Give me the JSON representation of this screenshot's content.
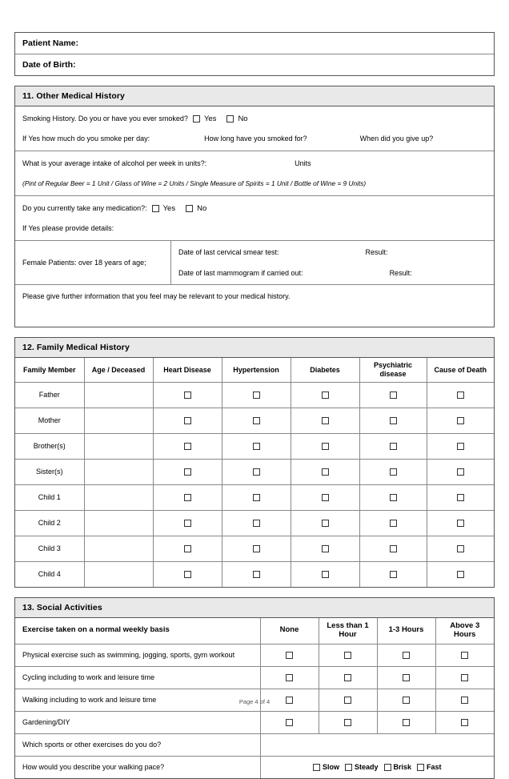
{
  "patient": {
    "name_label": "Patient Name:",
    "dob_label": "Date of Birth:"
  },
  "section11": {
    "heading": "11. Other Medical History",
    "smoking_question": "Smoking History. Do you or have you ever smoked?",
    "yes_label": "Yes",
    "no_label": "No",
    "smoke_per_day": "If Yes how much do you smoke per day:",
    "smoked_for": "How long have you smoked for?",
    "gave_up": "When did you give up?",
    "alcohol_question": "What is your average intake of alcohol per week in units?:",
    "units_label": "Units",
    "alcohol_note": "(Pint of Regular Beer =  1 Unit / Glass of Wine = 2 Units / Single Measure of Spirits = 1  Unit /  Bottle of Wine = 9 Units)",
    "medication_question": "Do you currently take any medication?:",
    "medication_details": "If Yes please provide details:",
    "female_label": "Female Patients: over 18 years of age;",
    "cervical_label": "Date of last cervical smear test:",
    "mammogram_label": "Date of last mammogram if carried out:",
    "result_label": "Result:",
    "further_info": "Please give further information that you feel may be relevant to your medical history."
  },
  "section12": {
    "heading": "12. Family Medical History",
    "columns": [
      "Family Member",
      "Age / Deceased",
      "Heart Disease",
      "Hypertension",
      "Diabetes",
      "Psychiatric disease",
      "Cause of Death"
    ],
    "rows": [
      "Father",
      "Mother",
      "Brother(s)",
      "Sister(s)",
      "Child 1",
      "Child 2",
      "Child 3",
      "Child 4"
    ]
  },
  "section13": {
    "heading": "13. Social Activities",
    "exercise_header": "Exercise taken on a normal weekly basis",
    "columns": [
      "None",
      "Less than 1 Hour",
      "1-3 Hours",
      "Above 3 Hours"
    ],
    "rows": [
      "Physical exercise such as swimming, jogging, sports, gym workout",
      "Cycling including to work and leisure time",
      "Walking including to work and leisure time",
      "Gardening/DIY"
    ],
    "sports_question": "Which sports or other exercises do you do?",
    "pace_question": "How would you describe your walking pace?",
    "pace_options": [
      "Slow",
      "Steady",
      "Brisk",
      "Fast"
    ]
  },
  "footer": {
    "page_label": "Page 4 of 4"
  },
  "colors": {
    "section_header_bg": "#e9e9e9",
    "outer_border": "#555555",
    "inner_border": "#888888"
  }
}
